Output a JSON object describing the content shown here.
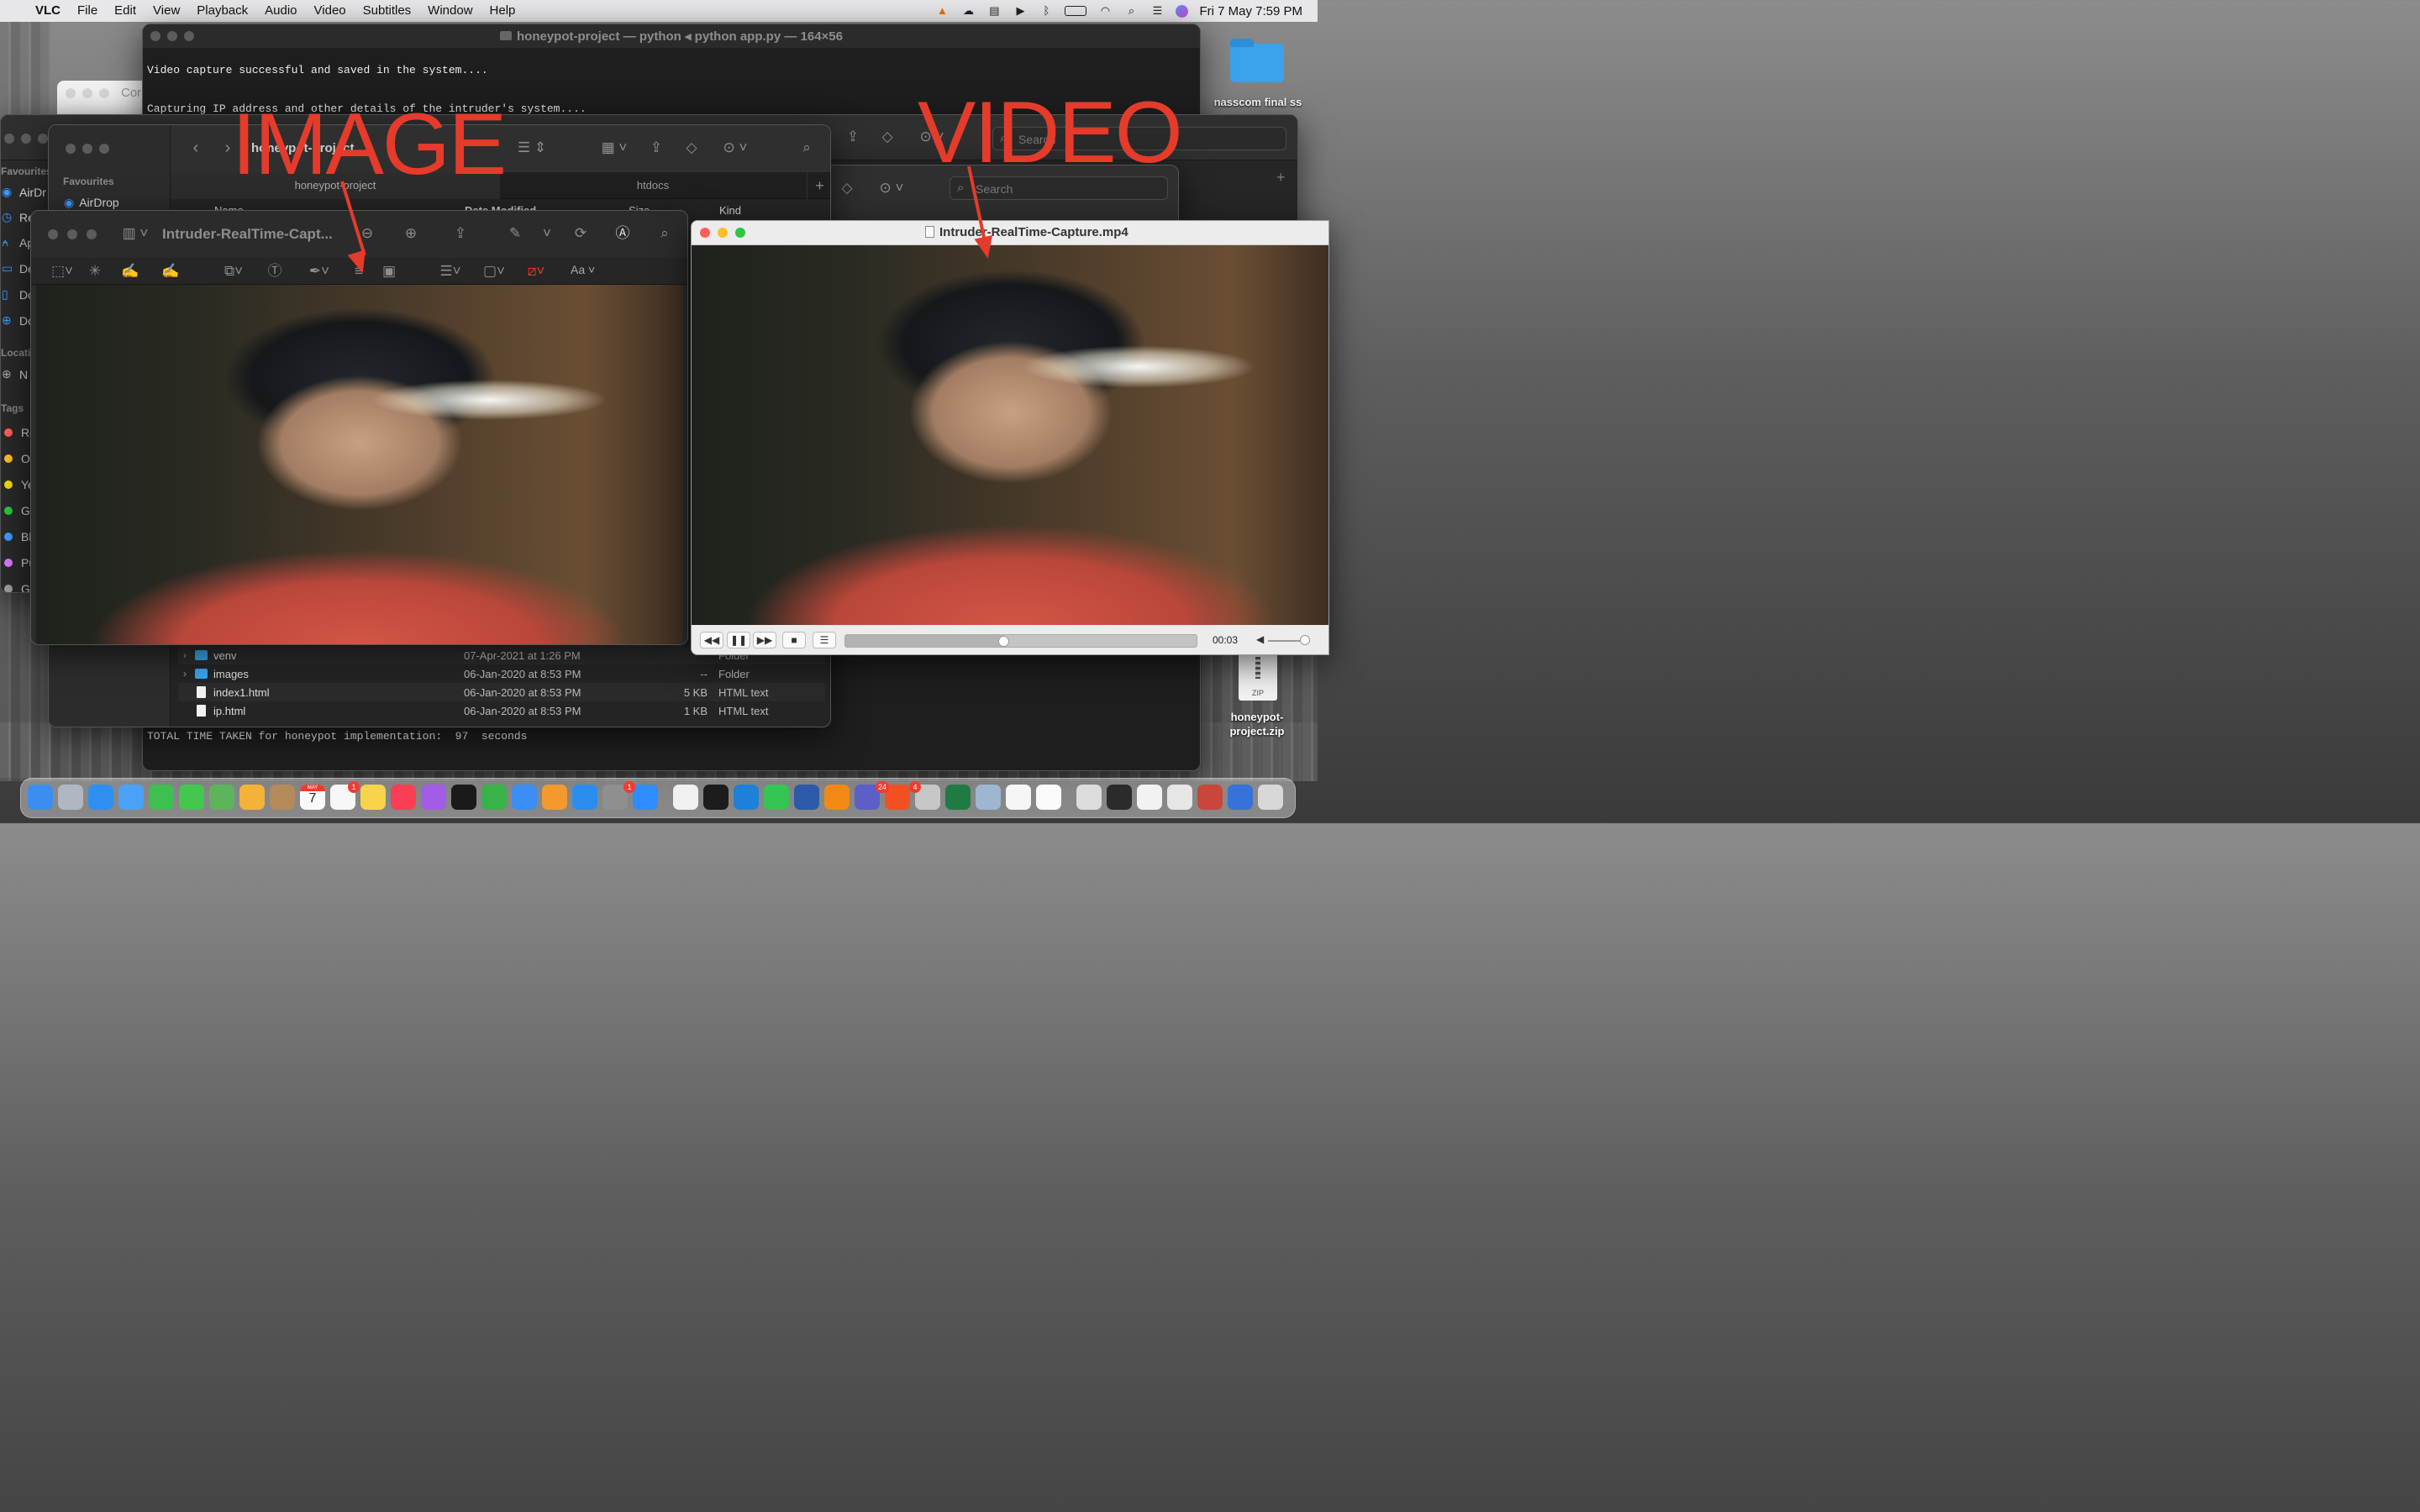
{
  "menubar": {
    "app": "VLC",
    "items": [
      "File",
      "Edit",
      "View",
      "Playback",
      "Audio",
      "Video",
      "Subtitles",
      "Window",
      "Help"
    ],
    "datetime": "Fri 7 May  7:59 PM"
  },
  "desktop": {
    "folder_label": "nasscom final ss",
    "zip_label": "honeypot-\nproject.zip",
    "zip_badge": "ZIP"
  },
  "terminal": {
    "title": "honeypot-project — python ◂ python app.py — 164×56",
    "line1": "Video capture successful and saved in the system....",
    "line2": "Capturing IP address and other details of the intruder's system....",
    "footer": "TOTAL TIME TAKEN for honeypot implementation:  97  seconds"
  },
  "bg_window": {
    "partial_title": "Cor"
  },
  "finder_back": {
    "sidebar_favourites": "Favourites",
    "items": [
      "AirDr",
      "Re",
      "Ap",
      "De",
      "Do",
      "Do"
    ],
    "locations_label": "Locati",
    "location_item": "N",
    "tags_label": "Tags",
    "tags": [
      {
        "name": "Re",
        "color": "#ff5f57"
      },
      {
        "name": "O",
        "color": "#ffbd2e"
      },
      {
        "name": "Ye",
        "color": "#f5d90a"
      },
      {
        "name": "G",
        "color": "#28c840"
      },
      {
        "name": "Bl",
        "color": "#3b9cff"
      },
      {
        "name": "Pu",
        "color": "#d57bff"
      },
      {
        "name": "G",
        "color": "#9e9e9e"
      }
    ],
    "search": "Search"
  },
  "finder": {
    "sidebar_heading": "Favourites",
    "airdrop": "AirDrop",
    "tabs": [
      "honeypot-project",
      "htdocs"
    ],
    "title": "honeypot-project",
    "columns": [
      "Name",
      "Date Modified",
      "Size",
      "Kind"
    ],
    "rows": [
      {
        "name": "venv",
        "date": "07-Apr-2021 at 1:26 PM",
        "size": "",
        "kind": "Folder",
        "type": "folder"
      },
      {
        "name": "images",
        "date": "06-Jan-2020 at 8:53 PM",
        "size": "--",
        "kind": "Folder",
        "type": "folder"
      },
      {
        "name": "index1.html",
        "date": "06-Jan-2020 at 8:53 PM",
        "size": "5 KB",
        "kind": "HTML text",
        "type": "file"
      },
      {
        "name": "ip.html",
        "date": "06-Jan-2020 at 8:53 PM",
        "size": "1 KB",
        "kind": "HTML text",
        "type": "file"
      }
    ]
  },
  "htdocs_window": {
    "search": "Search"
  },
  "preview": {
    "title": "Intruder-RealTime-Capt...",
    "font_button": "Aa"
  },
  "vlc": {
    "title": "Intruder-RealTime-Capture.mp4",
    "time": "00:03",
    "progress": 0.45
  },
  "annotations": {
    "image": "IMAGE",
    "video": "VIDEO",
    "color": "#e53b2b"
  },
  "dock": {
    "calendar_month": "MAY",
    "calendar_day": "7",
    "badges": [
      "1",
      "24",
      "4",
      "1"
    ]
  }
}
